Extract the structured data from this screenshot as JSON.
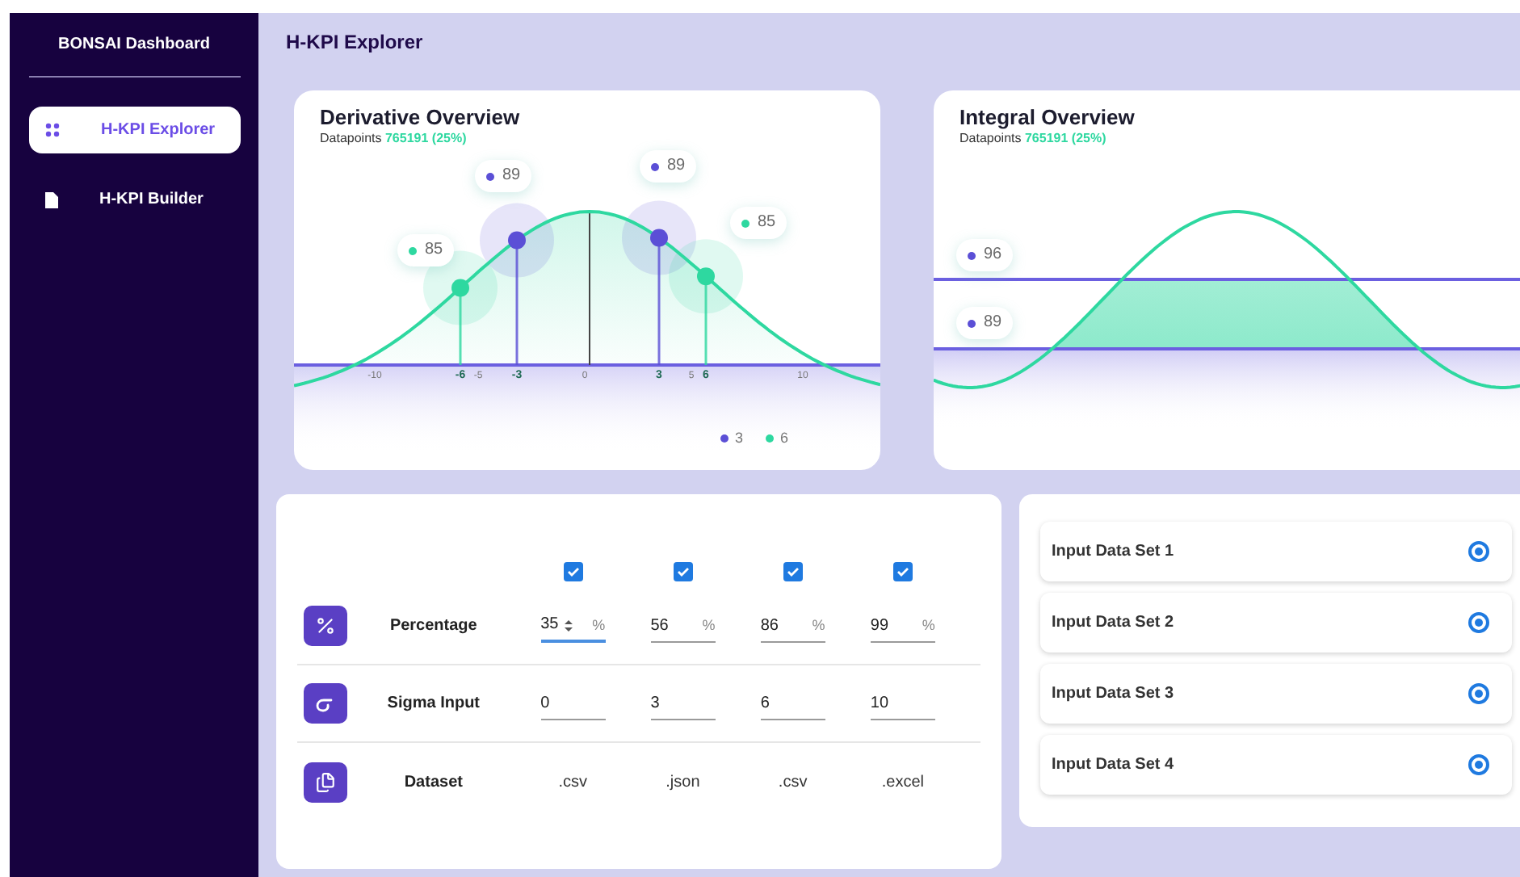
{
  "sidebar": {
    "title": "BONSAI Dashboard",
    "items": [
      {
        "kind": "grid",
        "label": "H-KPI Explorer",
        "selected": true
      },
      {
        "kind": "file",
        "label": "H-KPI Builder",
        "selected": false
      }
    ]
  },
  "page_title": "H-KPI Explorer",
  "derivative_overview": {
    "title": "Derivative Overview",
    "datapoints_label": "Datapoints",
    "datapoints_value": "765191 (25%)",
    "callouts": [
      {
        "text": "85",
        "color": "#2ed8a0"
      },
      {
        "text": "89",
        "color": "#5b4fd6"
      },
      {
        "text": "89",
        "color": "#5b4fd6"
      },
      {
        "text": "85",
        "color": "#2ed8a0"
      }
    ],
    "axis_labels": [
      {
        "text": "-10",
        "emphasized": false
      },
      {
        "text": "-6",
        "emphasized": true
      },
      {
        "text": "-5",
        "emphasized": false
      },
      {
        "text": "-3",
        "emphasized": true
      },
      {
        "text": "0",
        "emphasized": false
      },
      {
        "text": "3",
        "emphasized": true
      },
      {
        "text": "5",
        "emphasized": false
      },
      {
        "text": "6",
        "emphasized": true
      },
      {
        "text": "10",
        "emphasized": false
      }
    ],
    "legend": [
      {
        "text": "3",
        "color": "#5b4fd6"
      },
      {
        "text": "6",
        "color": "#2ed8a0"
      }
    ]
  },
  "integral_overview": {
    "title": "Integral Overview",
    "datapoints_label": "Datapoints",
    "datapoints_value": "765191 (25%)",
    "callouts": [
      {
        "text": "96",
        "color": "#5b4fd6"
      },
      {
        "text": "89",
        "color": "#5b4fd6"
      }
    ]
  },
  "parameters": {
    "checkboxes": [
      {
        "checked": true
      },
      {
        "checked": true
      },
      {
        "checked": true
      },
      {
        "checked": true
      }
    ],
    "rows": [
      {
        "kind": "percentage",
        "label": "Percentage",
        "inputs": [
          {
            "value": "35",
            "suffix": "%",
            "focused": true
          },
          {
            "value": "56",
            "suffix": "%",
            "focused": false
          },
          {
            "value": "86",
            "suffix": "%",
            "focused": false
          },
          {
            "value": "99",
            "suffix": "%",
            "focused": false
          }
        ]
      },
      {
        "kind": "sigma",
        "label": "Sigma Input",
        "inputs": [
          {
            "value": "0",
            "focused": false
          },
          {
            "value": "3",
            "focused": false
          },
          {
            "value": "6",
            "focused": false
          },
          {
            "value": "10",
            "focused": false
          }
        ]
      },
      {
        "kind": "dataset",
        "label": "Dataset",
        "values": [
          ".csv",
          ".json",
          ".csv",
          ".excel"
        ]
      }
    ]
  },
  "data_sets": [
    {
      "label": "Input Data Set 1",
      "selected": true
    },
    {
      "label": "Input Data Set 2",
      "selected": true
    },
    {
      "label": "Input Data Set 3",
      "selected": true
    },
    {
      "label": "Input Data Set 4",
      "selected": true
    }
  ]
}
